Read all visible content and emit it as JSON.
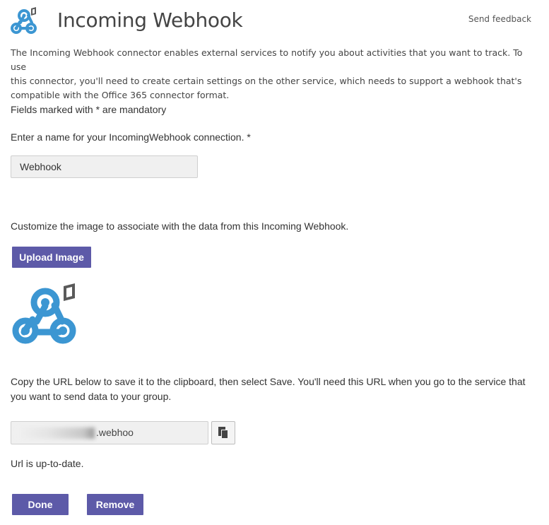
{
  "header": {
    "title": "Incoming Webhook",
    "feedback_label": "Send feedback",
    "logo_icon": "webhook-office-logo-icon"
  },
  "description": {
    "line1": "The Incoming Webhook connector enables external services to notify you about activities that you want to track. To use",
    "line2": "this connector, you'll need to create certain settings on the other service, which needs to support a webhook that's",
    "line3": "compatible with the Office 365 connector format."
  },
  "form": {
    "mandatory_note": "Fields marked with * are mandatory",
    "name_label": "Enter a name for your IncomingWebhook connection. *",
    "name_value": "Webhook",
    "image_label": "Customize the image to associate with the data from this Incoming Webhook.",
    "upload_button": "Upload Image",
    "url_instructions_line1": "Copy the URL below to save it to the clipboard, then select Save. You'll need this URL when you go to the service that",
    "url_instructions_line2": "you want to send data to your group.",
    "url_visible_text": ".webhoo",
    "copy_icon": "copy-clipboard-icon",
    "url_status": "Url is up-to-date.",
    "done_button": "Done",
    "remove_button": "Remove"
  },
  "colors": {
    "accent": "#5d5aa8",
    "webhook_blue": "#3c96d2"
  }
}
